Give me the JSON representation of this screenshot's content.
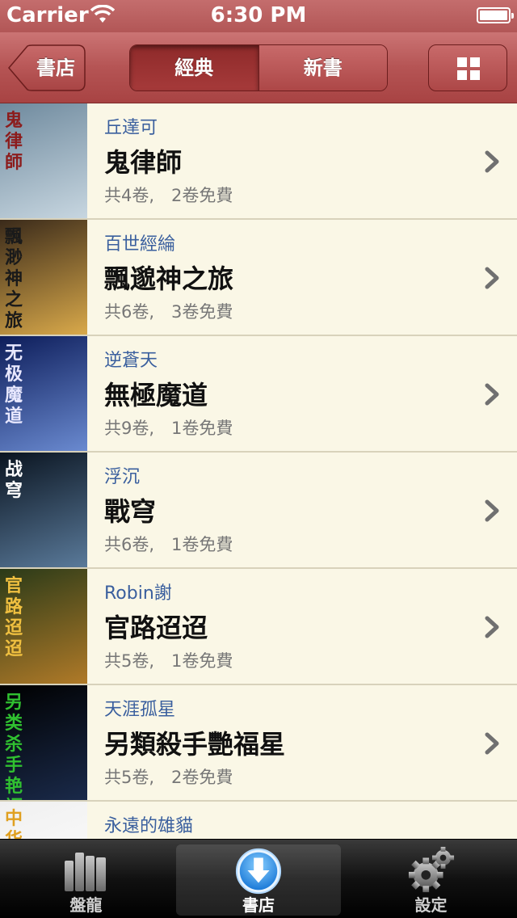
{
  "status_bar": {
    "carrier": "Carrier",
    "time": "6:30 PM",
    "wifi_icon": "wifi-icon",
    "battery_icon": "battery-icon"
  },
  "nav_bar": {
    "back_label": "書店",
    "segments": [
      {
        "label": "經典",
        "selected": true
      },
      {
        "label": "新書",
        "selected": false
      }
    ],
    "grid_icon": "grid-icon"
  },
  "books": [
    {
      "author": "丘達可",
      "title": "鬼律師",
      "volumes": "共4卷,　2卷免費"
    },
    {
      "author": "百世經綸",
      "title": "飄邈神之旅",
      "volumes": "共6卷,　3卷免費"
    },
    {
      "author": "逆蒼天",
      "title": "無極魔道",
      "volumes": "共9卷,　1卷免費"
    },
    {
      "author": "浮沉",
      "title": "戰穹",
      "volumes": "共6卷,　1卷免費"
    },
    {
      "author": "Robin謝",
      "title": "官路迢迢",
      "volumes": "共5卷,　1卷免費"
    },
    {
      "author": "天涯孤星",
      "title": "另類殺手艷福星",
      "volumes": "共5卷,　2卷免費"
    },
    {
      "author": "永遠的雄貓",
      "title": "",
      "volumes": ""
    }
  ],
  "covers": [
    {
      "text": "鬼律師",
      "colors": [
        "#6f8a9e",
        "#c7d6e0"
      ],
      "text_color": "#8c1c1c"
    },
    {
      "text": "飄渺神之旅",
      "colors": [
        "#3a2a1a",
        "#d9a94a"
      ],
      "text_color": "#1a1a1a"
    },
    {
      "text": "无极魔道",
      "colors": [
        "#0d1d5a",
        "#6a8ad0"
      ],
      "text_color": "#e8e8ff"
    },
    {
      "text": "战穹",
      "colors": [
        "#0a1420",
        "#5a7a9a"
      ],
      "text_color": "#ffffff"
    },
    {
      "text": "官路迢迢",
      "colors": [
        "#2a3a18",
        "#b07a28"
      ],
      "text_color": "#f0c040"
    },
    {
      "text": "另类杀手艳福星",
      "colors": [
        "#000000",
        "#1a2a4a"
      ],
      "text_color": "#30c030"
    },
    {
      "text": "中华",
      "colors": [
        "#f0f0f0",
        "#ffffff"
      ],
      "text_color": "#e0a020"
    }
  ],
  "tab_bar": {
    "tabs": [
      {
        "label": "盤龍",
        "icon": "bookshelf-icon",
        "selected": false
      },
      {
        "label": "書店",
        "icon": "download-icon",
        "selected": true
      },
      {
        "label": "設定",
        "icon": "gear-icon",
        "selected": false
      }
    ]
  },
  "colors": {
    "nav_accent": "#b55454",
    "author": "#3a5f9e",
    "row_bg": "#faf7e6"
  }
}
